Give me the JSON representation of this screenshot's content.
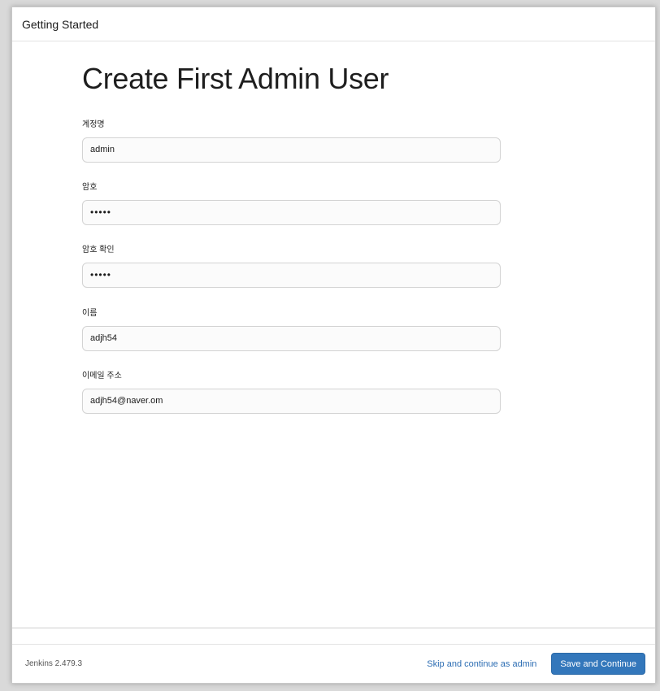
{
  "dialog": {
    "title": "Getting Started"
  },
  "form": {
    "heading": "Create First Admin User",
    "fields": [
      {
        "label": "계정명",
        "value": "admin",
        "type": "text"
      },
      {
        "label": "암호",
        "value": "•••••",
        "type": "password"
      },
      {
        "label": "암호 확인",
        "value": "•••••",
        "type": "password"
      },
      {
        "label": "이름",
        "value": "adjh54",
        "type": "text"
      },
      {
        "label": "이메일 주소",
        "value": "adjh54@naver.om",
        "type": "text"
      }
    ]
  },
  "footer": {
    "version": "Jenkins 2.479.3",
    "skip_label": "Skip and continue as admin",
    "save_label": "Save and Continue"
  },
  "colors": {
    "primary_button": "#3377bb",
    "link": "#2c6db3"
  }
}
